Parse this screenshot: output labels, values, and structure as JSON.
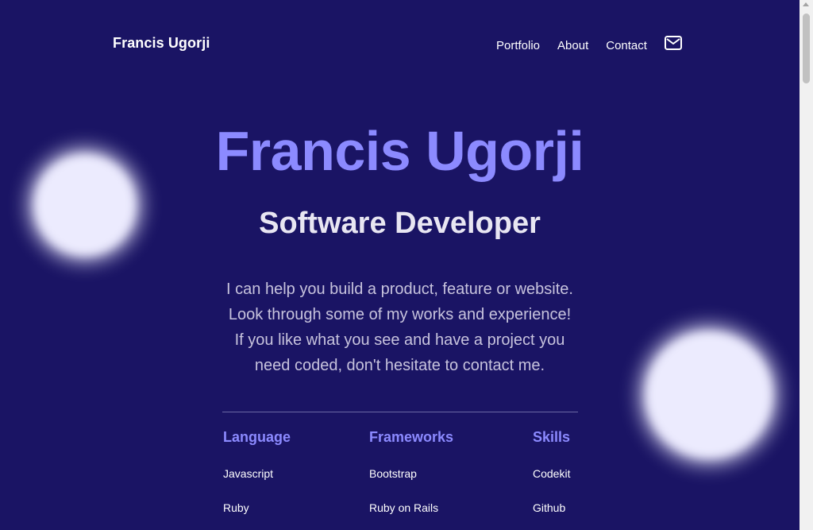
{
  "header": {
    "brand": "Francis Ugorji",
    "nav": {
      "portfolio": "Portfolio",
      "about": "About",
      "contact": "Contact"
    },
    "mail_icon": "mail-icon"
  },
  "hero": {
    "title": "Francis Ugorji",
    "subtitle": "Software Developer",
    "description": "I can help you build a product, feature or website. Look through some of my works and experience! If you like what you see and have a project you need coded, don't hesitate to contact me."
  },
  "skills": {
    "language": {
      "heading": "Language",
      "items": [
        "Javascript",
        "Ruby"
      ]
    },
    "frameworks": {
      "heading": "Frameworks",
      "items": [
        "Bootstrap",
        "Ruby on Rails"
      ]
    },
    "skills": {
      "heading": "Skills",
      "items": [
        "Codekit",
        "Github"
      ]
    }
  },
  "colors": {
    "background": "#1a1464",
    "accent": "#8c8aff",
    "blob": "#ecebfe"
  }
}
